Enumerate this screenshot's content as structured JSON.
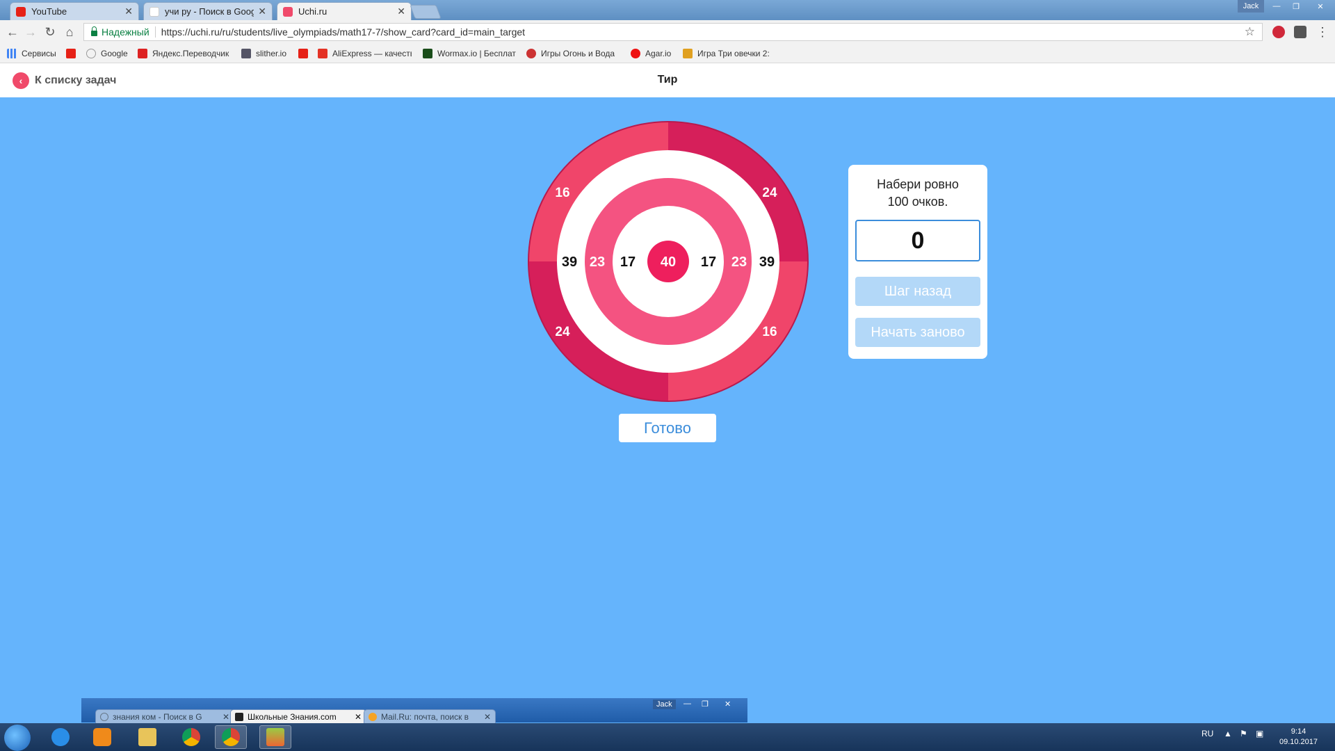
{
  "browser": {
    "tabs": [
      {
        "label": "YouTube",
        "active": false
      },
      {
        "label": "учи ру - Поиск в Google",
        "active": false
      },
      {
        "label": "Uchi.ru",
        "active": true
      }
    ],
    "user": "Jack",
    "security_label": "Надежный",
    "url": "https://uchi.ru/ru/students/live_olympiads/math17-7/show_card?card_id=main_target",
    "bookmarks": [
      {
        "label": "Сервисы"
      },
      {
        "label": "Google"
      },
      {
        "label": "Яндекс.Переводчик"
      },
      {
        "label": "slither.io"
      },
      {
        "label": "AliExpress — качеств"
      },
      {
        "label": "Wormax.io | Бесплат"
      },
      {
        "label": "Игры Огонь и Вода"
      },
      {
        "label": "Agar.io"
      },
      {
        "label": "Игра Три овечки 2: "
      }
    ]
  },
  "page": {
    "back_label": "К списку задач",
    "title": "Тир",
    "target": {
      "center": "40",
      "inner_left": "17",
      "inner_right": "17",
      "mid_left": "23",
      "mid_right": "23",
      "outer_left": "39",
      "outer_right": "39",
      "rim_top_left": "16",
      "rim_top_right": "24",
      "rim_bottom_left": "24",
      "rim_bottom_right": "16"
    },
    "task_line1": "Набери ровно",
    "task_line2": "100 очков.",
    "score": "0",
    "step_back_label": "Шаг назад",
    "restart_label": "Начать заново",
    "done_label": "Готово"
  },
  "second_window": {
    "tabs": [
      {
        "label": "знания ком - Поиск в G",
        "active": false
      },
      {
        "label": "Школьные Знания.com",
        "active": true
      },
      {
        "label": "Mail.Ru: почта, поиск в",
        "active": false
      }
    ],
    "user": "Jack"
  },
  "taskbar": {
    "lang": "RU",
    "time": "9:14",
    "date": "09.10.2017"
  },
  "colors": {
    "page_bg": "#65b4fc",
    "rim_light": "#f0456a",
    "rim_dark": "#d61f5a",
    "ring_pink": "#f45381",
    "bullseye": "#ee1f5d",
    "score_border": "#3b8ddb",
    "disabled_button": "#b3d8f8"
  }
}
